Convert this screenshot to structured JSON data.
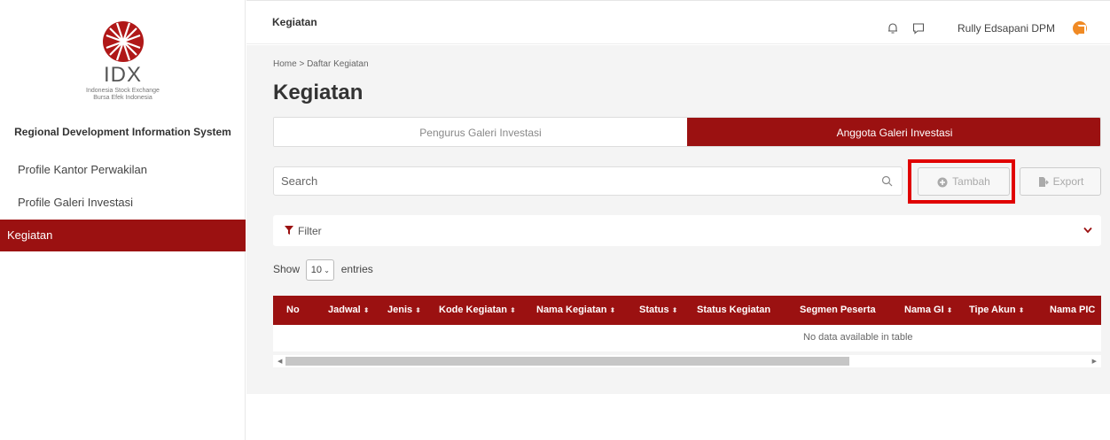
{
  "sidebar": {
    "logo_text": "IDX",
    "logo_sub1": "Indonesia Stock Exchange",
    "logo_sub2": "Bursa Efek Indonesia",
    "app_name": "Regional Development Information System",
    "items": [
      {
        "label": "Profile Kantor Perwakilan"
      },
      {
        "label": "Profile Galeri Investasi"
      },
      {
        "label": "Kegiatan"
      }
    ]
  },
  "header": {
    "title": "Kegiatan",
    "user_name": "Rully Edsapani DPM",
    "avatar_color": "#f08a24"
  },
  "main": {
    "breadcrumb": "Home > Daftar Kegiatan",
    "page_title": "Kegiatan",
    "tabs": [
      {
        "label": "Pengurus Galeri Investasi"
      },
      {
        "label": "Anggota Galeri Investasi"
      }
    ],
    "search_placeholder": "Search",
    "buttons": {
      "add": "Tambah",
      "export": "Export"
    },
    "filter_label": "Filter",
    "show_label": "Show",
    "entries_value": "10",
    "entries_label": "entries",
    "table": {
      "columns": [
        "No",
        "Jadwal",
        "Jenis",
        "Kode Kegiatan",
        "Nama Kegiatan",
        "Status",
        "Status Kegiatan",
        "Segmen Peserta",
        "Nama GI",
        "Tipe Akun",
        "Nama PIC"
      ],
      "empty_text": "No data available in table"
    }
  },
  "colors": {
    "accent": "#9b1111",
    "highlight": "#e00000"
  }
}
